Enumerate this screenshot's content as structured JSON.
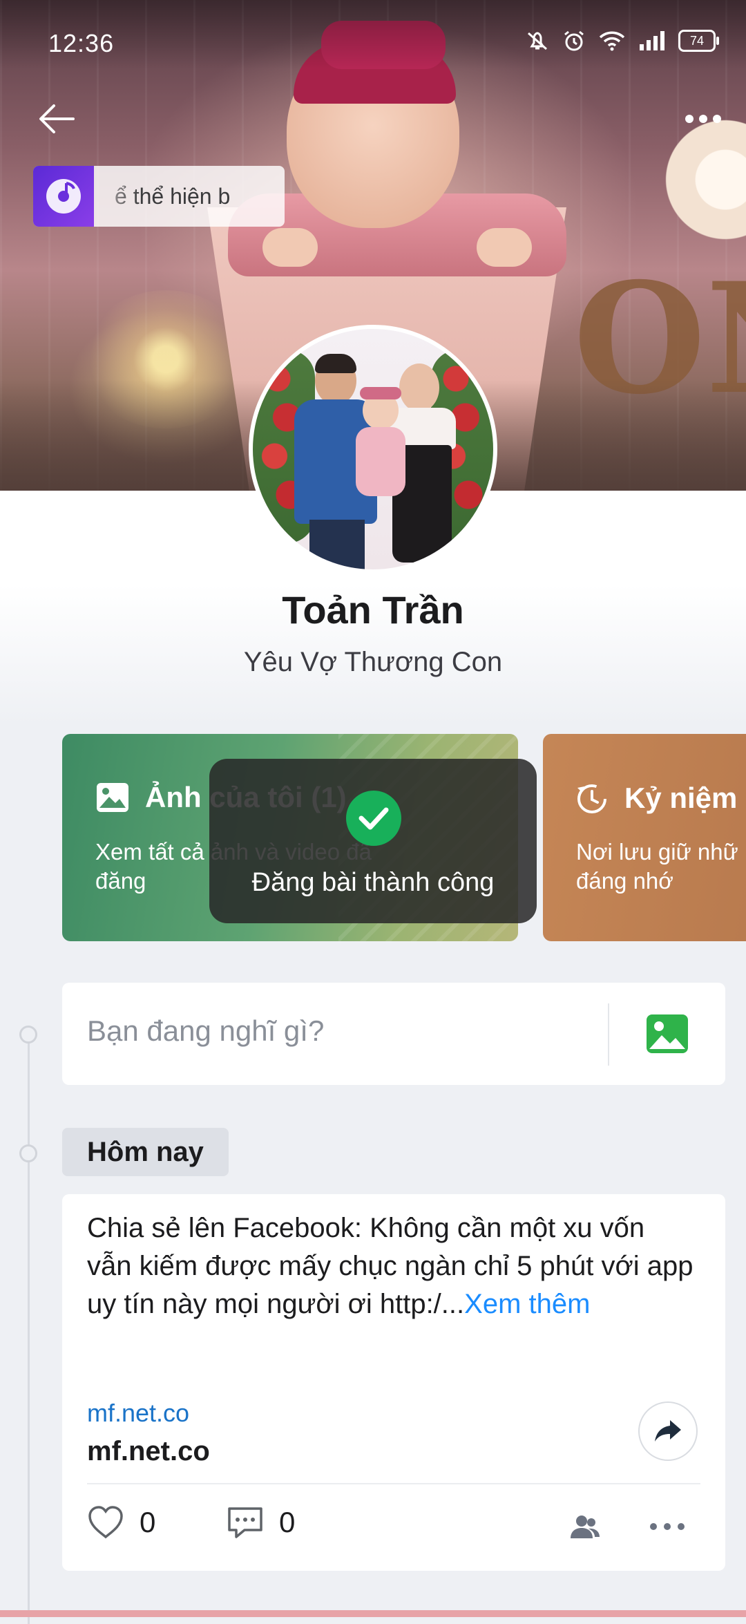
{
  "status_bar": {
    "time": "12:36",
    "battery": "74",
    "icons": [
      "mute-icon",
      "alarm-icon",
      "wifi-icon",
      "signal-icon",
      "battery-icon"
    ]
  },
  "header": {
    "back_icon": "arrow-left-icon",
    "more_icon": "more-horizontal-icon",
    "music_text": "ể thể hiện b"
  },
  "profile": {
    "name": "Toản Trần",
    "bio": "Yêu Vợ Thương Con"
  },
  "cards": [
    {
      "title": "Ảnh của tôi (1)",
      "description": "Xem tất cả ảnh và video đã đăng",
      "icon": "image-icon",
      "color": "#3e8b63"
    },
    {
      "title": "Kỷ niệm n",
      "description_line1": "Nơi lưu giữ nhữ",
      "description_line2": "đáng nhớ",
      "icon": "memory-clock-icon",
      "color": "#c58656"
    }
  ],
  "toast": {
    "text": "Đăng bài thành công",
    "icon": "check-circle-icon",
    "color": "#18b05a"
  },
  "composer": {
    "placeholder": "Bạn đang nghĩ gì?",
    "photo_icon": "photo-icon",
    "accent_color": "#2fb34a"
  },
  "timeline": {
    "date_label": "Hôm nay"
  },
  "post": {
    "text": "Chia sẻ lên Facebook: Không cần một xu vốn vẫn kiếm được mấy chục ngàn chỉ 5 phút với app uy tín này mọi người ơi http:/...",
    "see_more": "Xem thêm",
    "link_domain": "mf.net.co",
    "link_title": "mf.net.co",
    "likes": "0",
    "comments": "0",
    "link_color": "#1a8cff"
  }
}
